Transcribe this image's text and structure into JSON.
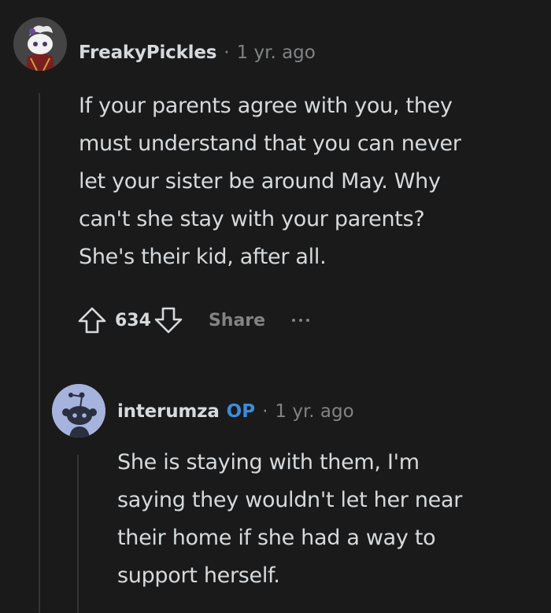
{
  "comment": {
    "username": "FreakyPickles",
    "separator": "·",
    "timestamp": "1 yr. ago",
    "body": "If your parents agree with you, they\nmust understand that you can never\nlet your sister be around May. Why\ncan't she stay with your parents?\nShe's their kid, after all.",
    "score": "634",
    "share_label": "Share",
    "upvote_icon": "upvote-arrow-icon",
    "downvote_icon": "downvote-arrow-icon",
    "more_icon": "more-options-icon"
  },
  "reply": {
    "username": "interumza",
    "op_badge": "OP",
    "separator": "·",
    "timestamp": "1 yr. ago",
    "body": "She is staying with them, I'm\nsaying they wouldn't let her near\ntheir home if she had a way to\nsupport herself."
  },
  "colors": {
    "background": "#1a1a1b",
    "text": "#d7dadc",
    "muted": "#818384",
    "op_blue": "#3b8ddb",
    "thread_line": "#343536",
    "reply_avatar_bg": "#a5b3dd"
  }
}
